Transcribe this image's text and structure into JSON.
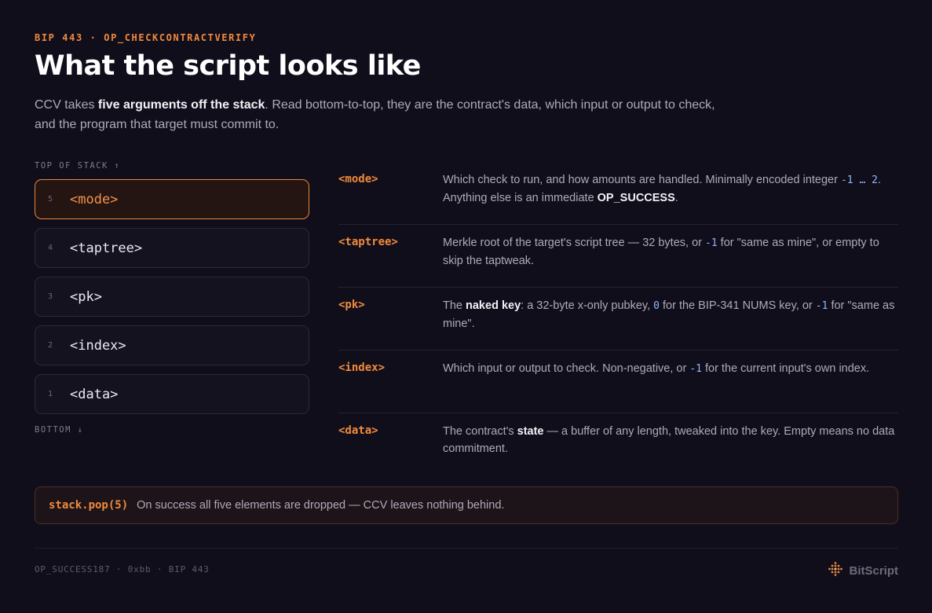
{
  "header": {
    "eyebrow": "BIP 443 · OP_CHECKCONTRACTVERIFY",
    "title": "What the script looks like",
    "lead_1": "CCV takes ",
    "lead_bold": "five arguments off the stack",
    "lead_2": ". Read bottom-to-top, they are the contract's data, which input or output to check, and the program that target must commit to."
  },
  "stack": {
    "top_caption": "TOP OF STACK ↑",
    "bottom_caption": "BOTTOM ↓",
    "items": [
      {
        "num": "5",
        "label": "<mode>"
      },
      {
        "num": "4",
        "label": "<taptree>"
      },
      {
        "num": "3",
        "label": "<pk>"
      },
      {
        "num": "2",
        "label": "<index>"
      },
      {
        "num": "1",
        "label": "<data>"
      }
    ],
    "active_index": 0
  },
  "definitions": [
    {
      "term": "<mode>",
      "a": "Which check to run, and how amounts are handled. Minimally encoded integer ",
      "c1": "-1 … 2",
      "b": ". Anything else is an immediate ",
      "bold": "OP_SUCCESS",
      "c": "."
    },
    {
      "term": "<taptree>",
      "a": "Merkle root of the target's script tree — 32 bytes, or ",
      "c1": "-1",
      "b": " for \"same as mine\", or empty to skip the taptweak."
    },
    {
      "term": "<pk>",
      "a": "The ",
      "bold": "naked key",
      "b": ": a 32-byte x-only pubkey, ",
      "c1": "0",
      "c": " for the BIP-341 NUMS key, or ",
      "c2": "-1",
      "d": " for \"same as mine\"."
    },
    {
      "term": "<index>",
      "a": "Which input or output to check. Non-negative, or ",
      "c1": "-1",
      "b": " for the current input's own index."
    },
    {
      "term": "<data>",
      "a": "The contract's ",
      "bold": "state",
      "b": " — a buffer of any length, tweaked into the key. Empty means no data commitment."
    }
  ],
  "callout": {
    "code": "stack.pop(5)",
    "text": "On success all five elements are dropped — CCV leaves nothing behind."
  },
  "footer": {
    "meta": "OP_SUCCESS187 · 0xbb · BIP 443",
    "brand": "BitScript"
  },
  "colors": {
    "background": "#110e1b",
    "accent": "#f08a3c",
    "code_blue": "#8fb6ff"
  },
  "icons": {
    "brand_logo": "bitscript-dot-grid-icon"
  }
}
